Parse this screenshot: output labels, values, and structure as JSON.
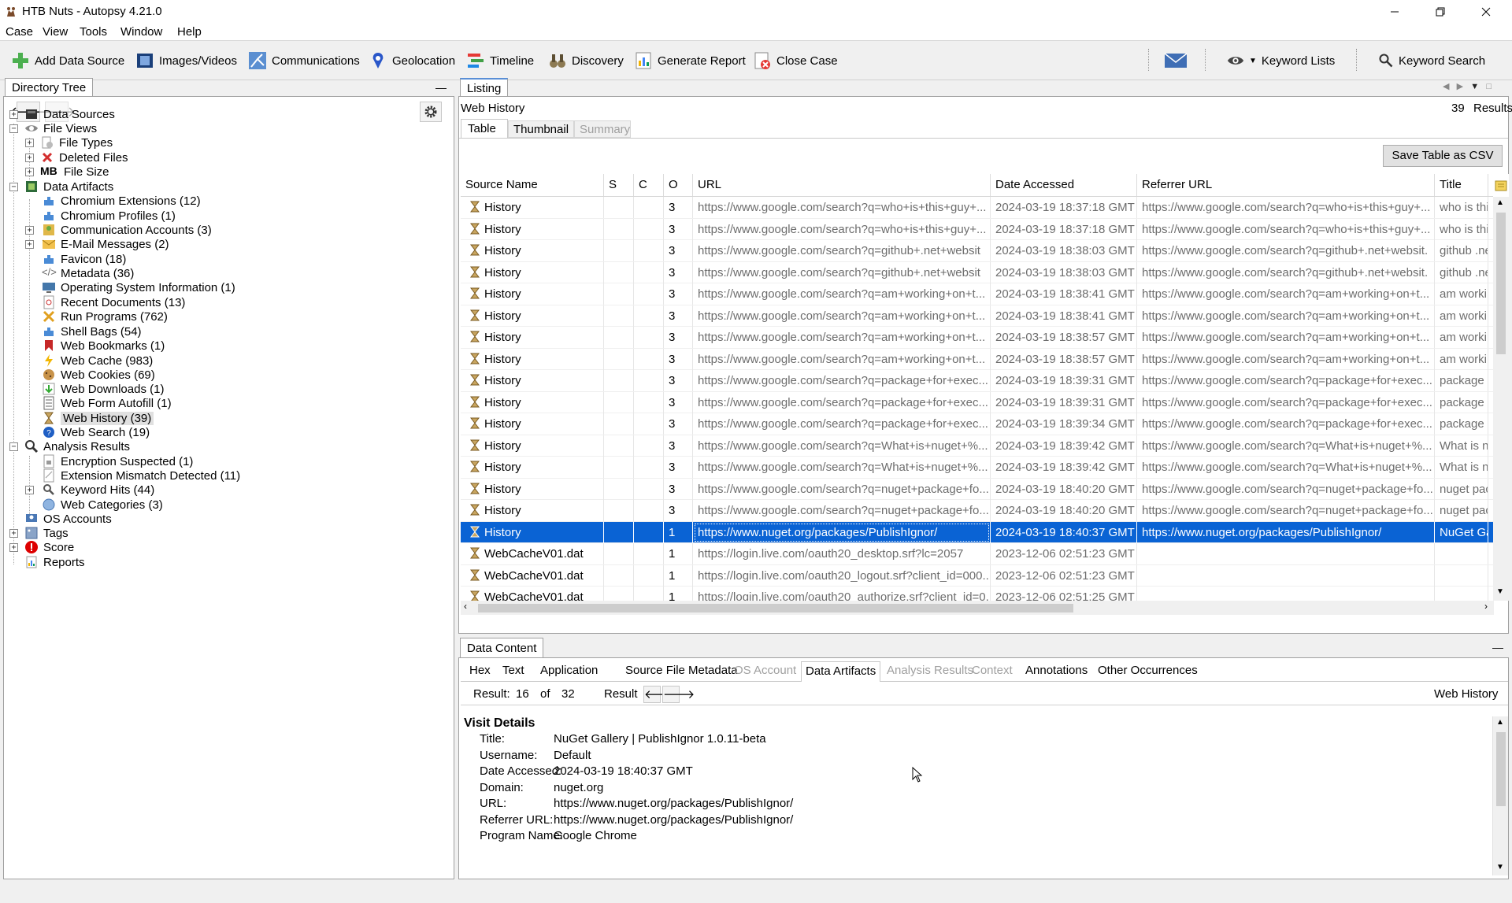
{
  "window": {
    "title": "HTB Nuts - Autopsy 4.21.0"
  },
  "menu": [
    "Case",
    "View",
    "Tools",
    "Window",
    "Help"
  ],
  "toolbar": {
    "add_data_source": "Add Data Source",
    "images_videos": "Images/Videos",
    "communications": "Communications",
    "geolocation": "Geolocation",
    "timeline": "Timeline",
    "discovery": "Discovery",
    "generate_report": "Generate Report",
    "close_case": "Close Case",
    "keyword_lists": "Keyword Lists",
    "keyword_search": "Keyword Search"
  },
  "directory_tree": {
    "tab_label": "Directory Tree",
    "nodes": {
      "data_sources": "Data Sources",
      "file_views": "File Views",
      "file_types": "File Types",
      "deleted_files": "Deleted Files",
      "file_size": "File Size",
      "data_artifacts": "Data Artifacts",
      "chromium_extensions": "Chromium Extensions (12)",
      "chromium_profiles": "Chromium Profiles (1)",
      "communication_accounts": "Communication Accounts (3)",
      "email_messages": "E-Mail Messages (2)",
      "favicon": "Favicon (18)",
      "metadata": "Metadata (36)",
      "os_information": "Operating System Information (1)",
      "recent_documents": "Recent Documents (13)",
      "run_programs": "Run Programs (762)",
      "shell_bags": "Shell Bags (54)",
      "web_bookmarks": "Web Bookmarks (1)",
      "web_cache": "Web Cache (983)",
      "web_cookies": "Web Cookies (69)",
      "web_downloads": "Web Downloads (1)",
      "web_form_autofill": "Web Form Autofill (1)",
      "web_history": "Web History (39)",
      "web_search": "Web Search (19)",
      "analysis_results": "Analysis Results",
      "encryption_suspected": "Encryption Suspected (1)",
      "extension_mismatch": "Extension Mismatch Detected (11)",
      "keyword_hits": "Keyword Hits (44)",
      "web_categories": "Web Categories (3)",
      "os_accounts": "OS Accounts",
      "tags": "Tags",
      "score": "Score",
      "reports": "Reports"
    }
  },
  "listing": {
    "tab_label": "Listing",
    "heading": "Web History",
    "results_count": "39",
    "results_label": "Results",
    "view_tabs": [
      "Table",
      "Thumbnail",
      "Summary"
    ],
    "save_csv": "Save Table as CSV",
    "columns": [
      "Source Name",
      "S",
      "C",
      "O",
      "URL",
      "Date Accessed",
      "Referrer URL",
      "Title"
    ],
    "rows": [
      {
        "source": "History",
        "o": "3",
        "url": "https://www.google.com/search?q=who+is+this+guy+...",
        "date": "2024-03-19 18:37:18 GMT",
        "referrer": "https://www.google.com/search?q=who+is+this+guy+...",
        "title": "who is thi"
      },
      {
        "source": "History",
        "o": "3",
        "url": "https://www.google.com/search?q=who+is+this+guy+...",
        "date": "2024-03-19 18:37:18 GMT",
        "referrer": "https://www.google.com/search?q=who+is+this+guy+...",
        "title": "who is thi"
      },
      {
        "source": "History",
        "o": "3",
        "url": "https://www.google.com/search?q=github+.net+websit",
        "date": "2024-03-19 18:38:03 GMT",
        "referrer": "https://www.google.com/search?q=github+.net+websit.",
        "title": "github .ne"
      },
      {
        "source": "History",
        "o": "3",
        "url": "https://www.google.com/search?q=github+.net+websit",
        "date": "2024-03-19 18:38:03 GMT",
        "referrer": "https://www.google.com/search?q=github+.net+websit.",
        "title": "github .ne"
      },
      {
        "source": "History",
        "o": "3",
        "url": "https://www.google.com/search?q=am+working+on+t...",
        "date": "2024-03-19 18:38:41 GMT",
        "referrer": "https://www.google.com/search?q=am+working+on+t...",
        "title": "am workin"
      },
      {
        "source": "History",
        "o": "3",
        "url": "https://www.google.com/search?q=am+working+on+t...",
        "date": "2024-03-19 18:38:41 GMT",
        "referrer": "https://www.google.com/search?q=am+working+on+t...",
        "title": "am workin"
      },
      {
        "source": "History",
        "o": "3",
        "url": "https://www.google.com/search?q=am+working+on+t...",
        "date": "2024-03-19 18:38:57 GMT",
        "referrer": "https://www.google.com/search?q=am+working+on+t...",
        "title": "am workin"
      },
      {
        "source": "History",
        "o": "3",
        "url": "https://www.google.com/search?q=am+working+on+t...",
        "date": "2024-03-19 18:38:57 GMT",
        "referrer": "https://www.google.com/search?q=am+working+on+t...",
        "title": "am workin"
      },
      {
        "source": "History",
        "o": "3",
        "url": "https://www.google.com/search?q=package+for+exec...",
        "date": "2024-03-19 18:39:31 GMT",
        "referrer": "https://www.google.com/search?q=package+for+exec...",
        "title": "package f"
      },
      {
        "source": "History",
        "o": "3",
        "url": "https://www.google.com/search?q=package+for+exec...",
        "date": "2024-03-19 18:39:31 GMT",
        "referrer": "https://www.google.com/search?q=package+for+exec...",
        "title": "package f"
      },
      {
        "source": "History",
        "o": "3",
        "url": "https://www.google.com/search?q=package+for+exec...",
        "date": "2024-03-19 18:39:34 GMT",
        "referrer": "https://www.google.com/search?q=package+for+exec...",
        "title": "package f"
      },
      {
        "source": "History",
        "o": "3",
        "url": "https://www.google.com/search?q=What+is+nuget+%...",
        "date": "2024-03-19 18:39:42 GMT",
        "referrer": "https://www.google.com/search?q=What+is+nuget+%...",
        "title": "What is nu"
      },
      {
        "source": "History",
        "o": "3",
        "url": "https://www.google.com/search?q=What+is+nuget+%...",
        "date": "2024-03-19 18:39:42 GMT",
        "referrer": "https://www.google.com/search?q=What+is+nuget+%...",
        "title": "What is nu"
      },
      {
        "source": "History",
        "o": "3",
        "url": "https://www.google.com/search?q=nuget+package+fo...",
        "date": "2024-03-19 18:40:20 GMT",
        "referrer": "https://www.google.com/search?q=nuget+package+fo...",
        "title": "nuget pac"
      },
      {
        "source": "History",
        "o": "3",
        "url": "https://www.google.com/search?q=nuget+package+fo...",
        "date": "2024-03-19 18:40:20 GMT",
        "referrer": "https://www.google.com/search?q=nuget+package+fo...",
        "title": "nuget pac"
      },
      {
        "source": "History",
        "o": "1",
        "url": "https://www.nuget.org/packages/PublishIgnor/",
        "date": "2024-03-19 18:40:37 GMT",
        "referrer": "https://www.nuget.org/packages/PublishIgnor/",
        "title": "NuGet Ga",
        "selected": true
      },
      {
        "source": "WebCacheV01.dat",
        "o": "1",
        "url": "https://login.live.com/oauth20_desktop.srf?lc=2057",
        "date": "2023-12-06 02:51:23 GMT",
        "referrer": "",
        "title": ""
      },
      {
        "source": "WebCacheV01.dat",
        "o": "1",
        "url": "https://login.live.com/oauth20_logout.srf?client_id=000...",
        "date": "2023-12-06 02:51:23 GMT",
        "referrer": "",
        "title": ""
      },
      {
        "source": "WebCacheV01.dat",
        "o": "1",
        "url": "https://login.live.com/oauth20_authorize.srf?client_id=0...",
        "date": "2023-12-06 02:51:25 GMT",
        "referrer": "",
        "title": ""
      }
    ]
  },
  "data_content": {
    "tab_label": "Data Content",
    "tabs": [
      {
        "label": "Hex",
        "disabled": false
      },
      {
        "label": "Text",
        "disabled": false
      },
      {
        "label": "Application",
        "disabled": false
      },
      {
        "label": "Source File Metadata",
        "disabled": false
      },
      {
        "label": "OS Account",
        "disabled": true
      },
      {
        "label": "Data Artifacts",
        "disabled": false,
        "active": true
      },
      {
        "label": "Analysis Results",
        "disabled": true
      },
      {
        "label": "Context",
        "disabled": true
      },
      {
        "label": "Annotations",
        "disabled": false
      },
      {
        "label": "Other Occurrences",
        "disabled": false
      }
    ],
    "result_label": "Result:",
    "result_index": "16",
    "of_label": "of",
    "result_total": "32",
    "result_nav_label": "Result",
    "artifact_type": "Web History",
    "section_title": "Visit Details",
    "details": [
      {
        "label": "Title:",
        "value": "NuGet Gallery | PublishIgnor 1.0.11-beta"
      },
      {
        "label": "Username:",
        "value": "Default"
      },
      {
        "label": "Date Accessed:",
        "value": "2024-03-19 18:40:37 GMT"
      },
      {
        "label": "Domain:",
        "value": "nuget.org"
      },
      {
        "label": "URL:",
        "value": "https://www.nuget.org/packages/PublishIgnor/"
      },
      {
        "label": "Referrer URL:",
        "value": "https://www.nuget.org/packages/PublishIgnor/"
      },
      {
        "label": "Program Name:",
        "value": "Google Chrome"
      }
    ]
  },
  "colors": {
    "selection": "#0a63d4",
    "muted_text": "#6d6d6d",
    "disabled_text": "#a0a0a0"
  }
}
